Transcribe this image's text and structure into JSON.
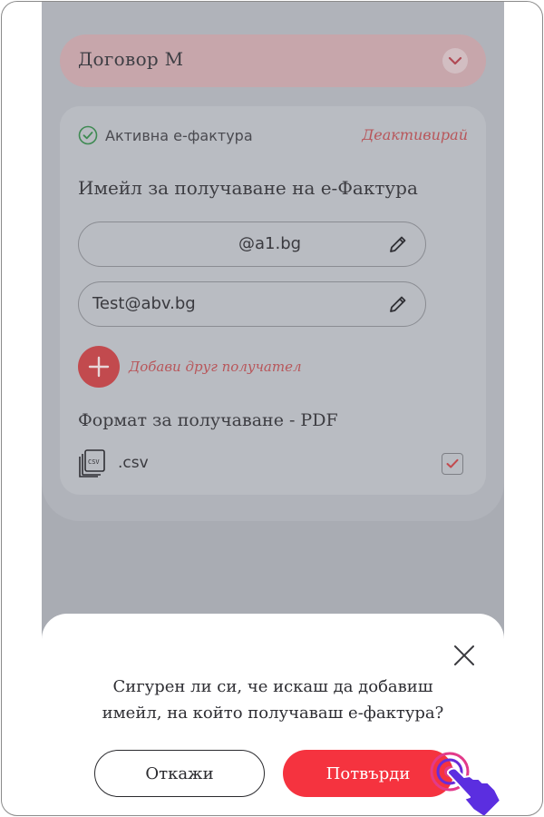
{
  "contract": {
    "name": "Договор М"
  },
  "einvoice": {
    "status": "Активна е-фактура",
    "deactivate": "Деактивирай",
    "email_title": "Имейл за получаване на е-Фактура",
    "emails": [
      {
        "value": "@a1.bg"
      },
      {
        "value": "Test@abv.bg"
      }
    ],
    "add_recipient": "Добави друг получател",
    "format_title": "Формат за получаване - PDF",
    "csv_label": ".csv",
    "csv_checked": true
  },
  "dialog": {
    "question_line1": "Сигурен ли си, че искаш да добавиш",
    "question_line2": "имейл, на който получаваш е-фактура?",
    "cancel": "Откажи",
    "confirm": "Потвърди"
  },
  "colors": {
    "accent": "#f5333f",
    "overlay": "#a9acb3"
  },
  "icons": [
    "chevron-down-icon",
    "check-circle-icon",
    "pencil-icon",
    "plus-icon",
    "csv-file-icon",
    "checkbox-icon",
    "close-icon",
    "hand-cursor-icon"
  ]
}
